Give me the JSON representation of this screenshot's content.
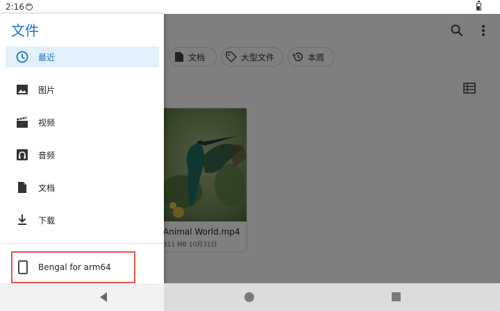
{
  "status_bar": {
    "time": "2:16"
  },
  "drawer": {
    "title": "文件",
    "items": [
      {
        "label": "最近",
        "icon": "clock-icon",
        "active": true
      },
      {
        "label": "图片",
        "icon": "image-icon",
        "active": false
      },
      {
        "label": "视频",
        "icon": "video-icon",
        "active": false
      },
      {
        "label": "音频",
        "icon": "audio-icon",
        "active": false
      },
      {
        "label": "文档",
        "icon": "document-icon",
        "active": false
      },
      {
        "label": "下载",
        "icon": "download-icon",
        "active": false
      }
    ],
    "device": {
      "label": "Bengal for arm64",
      "icon": "phone-icon"
    }
  },
  "main": {
    "chips": [
      {
        "label": "文档",
        "icon": "document-icon"
      },
      {
        "label": "大型文件",
        "icon": "tag-icon"
      },
      {
        "label": "本周",
        "icon": "history-icon"
      }
    ],
    "files": [
      {
        "name": "Animal World.mp4",
        "meta": "311 MB 10月31日"
      }
    ]
  },
  "colors": {
    "accent": "#1a73c8",
    "active_bg": "#e2f0fb",
    "highlight_border": "#e5534b"
  }
}
